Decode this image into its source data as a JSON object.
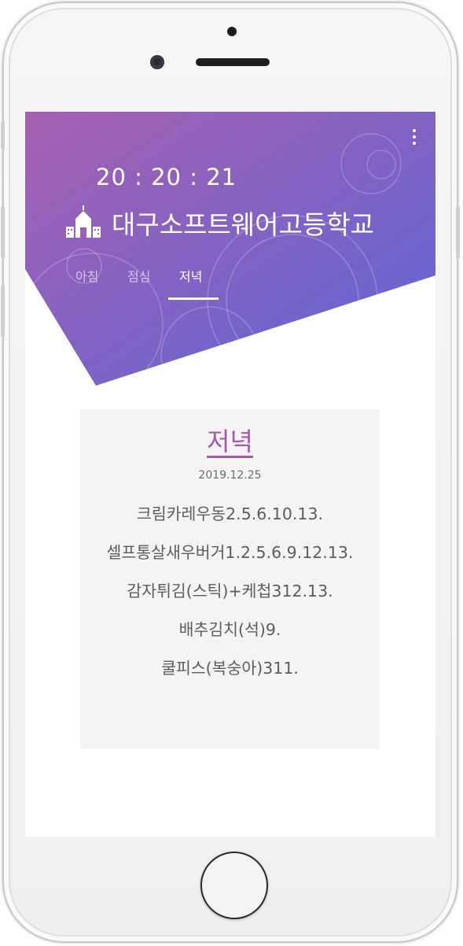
{
  "app": {
    "time": "20 : 20 : 21",
    "school_name": "대구소프트웨어고등학교",
    "icons": {
      "menu": "more-vertical-icon",
      "school": "school-icon"
    },
    "colors": {
      "gradient_start": "#a65fb0",
      "gradient_end": "#5d67d6",
      "accent": "#a45aad"
    }
  },
  "tabs": [
    {
      "label": "아침",
      "active": false
    },
    {
      "label": "점심",
      "active": false
    },
    {
      "label": "저녁",
      "active": true
    }
  ],
  "meal_card": {
    "title": "저녁",
    "date": "2019.12.25",
    "items": [
      "크림카레우동2.5.6.10.13.",
      "셀프통살새우버거1.2.5.6.9.12.13.",
      "감자튀김(스틱)+케첩312.13.",
      "배추김치(석)9.",
      "쿨피스(복숭아)311."
    ]
  }
}
